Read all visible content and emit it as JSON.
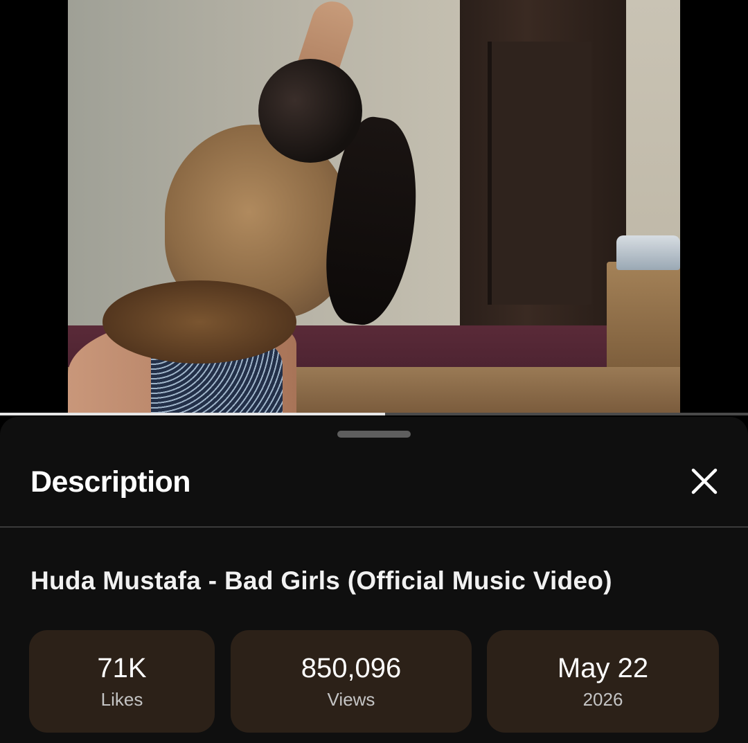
{
  "player": {
    "progress_fraction": 0.515
  },
  "sheet": {
    "title": "Description",
    "close_icon": "close-icon"
  },
  "video": {
    "title": "Huda Mustafa - Bad Girls (Official Music Video)"
  },
  "stats": [
    {
      "value": "71K",
      "label": "Likes"
    },
    {
      "value": "850,096",
      "label": "Views"
    },
    {
      "value": "May 22",
      "label": "2026"
    }
  ],
  "colors": {
    "sheet_bg": "#0f0f0f",
    "stat_bg": "#2c2118",
    "progress": "#e6e6e6"
  }
}
